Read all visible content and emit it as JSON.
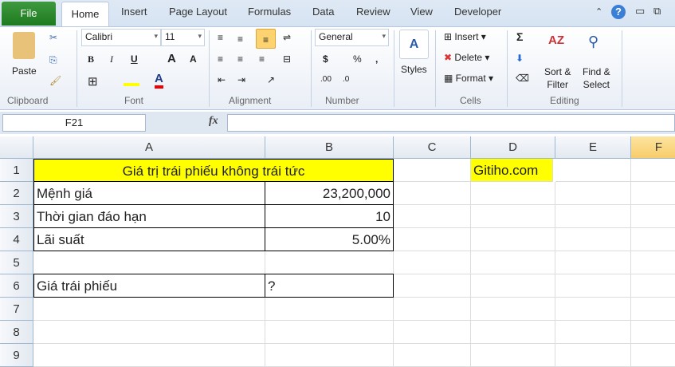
{
  "tabs": [
    "File",
    "Home",
    "Insert",
    "Page Layout",
    "Formulas",
    "Data",
    "Review",
    "View",
    "Developer"
  ],
  "ribbon": {
    "clipboard": {
      "paste": "Paste",
      "label": "Clipboard"
    },
    "font": {
      "name": "Calibri",
      "size": "11",
      "label": "Font",
      "bold": "B",
      "italic": "I",
      "underline": "U"
    },
    "alignment": {
      "label": "Alignment"
    },
    "number": {
      "format": "General",
      "label": "Number",
      "currency": "$",
      "percent": "%",
      "comma": ","
    },
    "styles": {
      "label": "Styles"
    },
    "cells": {
      "insert": "Insert",
      "delete": "Delete",
      "format": "Format",
      "label": "Cells"
    },
    "editing": {
      "sort1": "Sort &",
      "sort2": "Filter",
      "find1": "Find &",
      "find2": "Select",
      "label": "Editing"
    }
  },
  "formula_bar": {
    "name_box": "F21",
    "fx": "fx",
    "value": ""
  },
  "columns": [
    "A",
    "B",
    "C",
    "D",
    "E",
    "F"
  ],
  "rows": [
    "1",
    "2",
    "3",
    "4",
    "5",
    "6",
    "7",
    "8",
    "9"
  ],
  "cells": {
    "A1": "Giá trị trái phiếu không trái tức",
    "D1": "Gitiho.com",
    "A2": "Mệnh giá",
    "B2": "23,200,000",
    "A3": "Thời gian đáo hạn",
    "B3": "10",
    "A4": "Lãi suất",
    "B4": "5.00%",
    "A6": "Giá trái phiếu",
    "B6": "?"
  },
  "colors": {
    "highlight": "#ffff00",
    "file_tab": "#2a8a2a"
  }
}
